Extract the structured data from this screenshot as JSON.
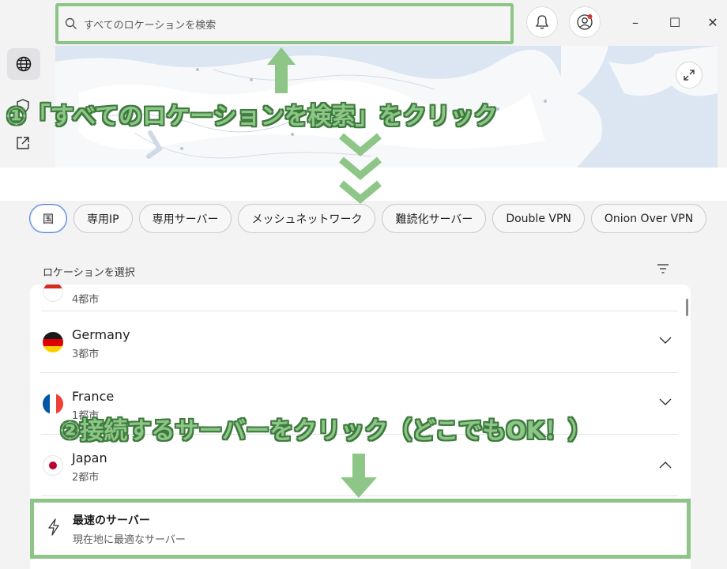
{
  "search": {
    "placeholder": "すべてのロケーションを検索"
  },
  "icons": {
    "search": "search-icon",
    "bell": "bell-icon",
    "account": "account-icon",
    "globe": "globe-icon",
    "expand": "expand-icon",
    "filter": "filter-icon",
    "bolt": "lightning-icon",
    "chevron": "chevron-icon"
  },
  "window": {
    "minimize": "–",
    "maximize": "☐",
    "close": "✕"
  },
  "annotations": {
    "step1": "①「すべてのロケーションを検索」をクリック",
    "step2": "②接続するサーバーをクリック（どこでもOK！）"
  },
  "chips": [
    {
      "label": "国",
      "active": true
    },
    {
      "label": "専用IP"
    },
    {
      "label": "専用サーバー"
    },
    {
      "label": "メッシュネットワーク"
    },
    {
      "label": "難読化サーバー"
    },
    {
      "label": "Double VPN"
    },
    {
      "label": "Onion Over VPN"
    }
  ],
  "locations": {
    "section_label": "ロケーションを選択",
    "partial_row_sub": "4都市",
    "rows": [
      {
        "name": "Germany",
        "sub": "3都市"
      },
      {
        "name": "France",
        "sub": "1都市"
      },
      {
        "name": "Japan",
        "sub": "2都市"
      }
    ],
    "fastest": {
      "title": "最速のサーバー",
      "sub": "現在地に最適なサーバー"
    }
  },
  "colors": {
    "annotation_green": "#8dc687",
    "annotation_outline": "#3d7a3d",
    "box_green": "#8fc489",
    "accent_blue": "#4e7fe0"
  }
}
